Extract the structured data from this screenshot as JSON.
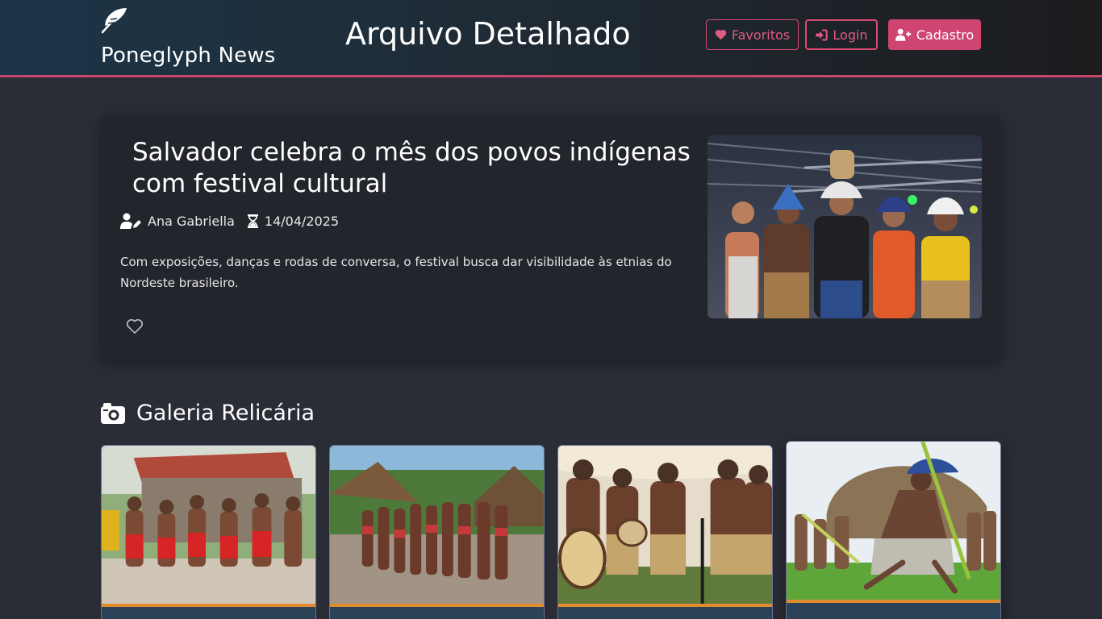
{
  "header": {
    "brand_name": "Poneglyph News",
    "page_title": "Arquivo Detalhado",
    "buttons": {
      "favorites": "Favoritos",
      "login": "Login",
      "signup": "Cadastro"
    },
    "accent_color": "#c8466c"
  },
  "article": {
    "headline": "Salvador celebra o mês dos povos indígenas com festival cultural",
    "author": "Ana Gabriella",
    "date": "14/04/2025",
    "summary": "Com exposições, danças e rodas de conversa, o festival busca dar visibilidade às etnias do Nordeste brasileiro.",
    "hero_image": "indigenous-leaders-celebration-photo"
  },
  "gallery": {
    "title": "Galeria Relicária",
    "items": [
      "indigenous-dancers-red-attire-photo",
      "indigenous-group-procession-photo",
      "indigenous-drummers-ceremony-photo",
      "indigenous-dancer-with-spear-photo"
    ]
  },
  "icons": [
    "feather-icon",
    "heart-icon",
    "login-icon",
    "user-plus-icon",
    "user-pen-icon",
    "hourglass-icon",
    "heart-outline-icon",
    "camera-icon"
  ]
}
